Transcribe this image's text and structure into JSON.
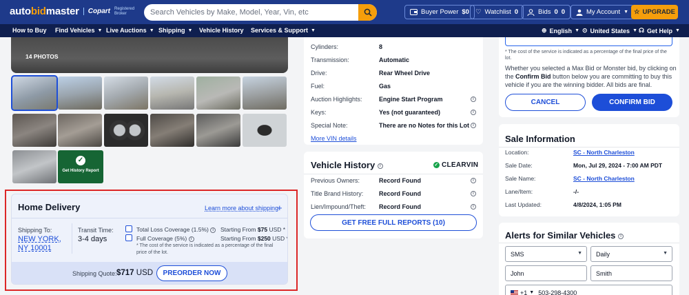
{
  "header": {
    "logo": {
      "auto": "auto",
      "bid": "bid",
      "master": "master",
      "partner": "Copart",
      "partner_note": "Registered Broker"
    },
    "search_placeholder": "Search Vehicles by Make, Model, Year, Vin, etc",
    "buyer_power_label": "Buyer Power",
    "buyer_power_value": "$0",
    "watchlist_label": "Watchlist",
    "watchlist_count": "0",
    "bids_label": "Bids",
    "bids_count_a": "0",
    "bids_count_b": "0",
    "account_label": "My Account",
    "upgrade_label": "UPGRADE"
  },
  "nav": {
    "items": [
      "How to Buy",
      "Find Vehicles",
      "Live Auctions",
      "Shipping",
      "Vehicle History",
      "Services & Support"
    ],
    "language": "English",
    "country": "United States",
    "help": "Get Help"
  },
  "gallery": {
    "photo_count": "14 PHOTOS",
    "history_report_label": "Get History Report"
  },
  "home_delivery": {
    "title": "Home Delivery",
    "learn_more": "Learn more about shipping",
    "shipping_to_label": "Shipping To:",
    "shipping_to_city": "NEW YORK, NY 10001",
    "transit_label": "Transit Time:",
    "transit_value": "3-4 days",
    "total_loss_label": "Total Loss Coverage (1.5%)",
    "total_loss_from": "Starting From",
    "total_loss_price": "$75",
    "total_loss_currency": "USD *",
    "full_cov_label": "Full Coverage (5%)",
    "full_cov_from": "Starting From",
    "full_cov_price": "$250",
    "full_cov_currency": "USD *",
    "coverage_note": "* The cost of the service is indicated as a percentage of the final price of the lot.",
    "quote_label": "Shipping Quote:",
    "quote_value": "$717",
    "quote_currency": "USD",
    "preorder_label": "PREORDER NOW"
  },
  "specs": {
    "rows": [
      {
        "k": "Cylinders:",
        "v": "8"
      },
      {
        "k": "Transmission:",
        "v": "Automatic"
      },
      {
        "k": "Drive:",
        "v": "Rear Wheel Drive"
      },
      {
        "k": "Fuel:",
        "v": "Gas"
      },
      {
        "k": "Auction Highlights:",
        "v": "Engine Start Program"
      },
      {
        "k": "Keys:",
        "v": "Yes (not guaranteed)"
      },
      {
        "k": "Special Note:",
        "v": "There are no Notes for this Lot"
      }
    ],
    "more_vin": "More VIN details"
  },
  "vehicle_history": {
    "title": "Vehicle History",
    "provider": "CLEARVIN",
    "rows": [
      {
        "k": "Previous Owners:",
        "v": "Record Found"
      },
      {
        "k": "Title Brand History:",
        "v": "Record Found"
      },
      {
        "k": "Lien/Impound/Theft:",
        "v": "Record Found"
      }
    ],
    "button": "GET FREE FULL REPORTS (10)"
  },
  "bid_confirm": {
    "note": "* The cost of the service is indicated as a percentage of the final price of the lot.",
    "text_a": "Whether you selected a Max Bid or Monster bid, by clicking on the",
    "text_bold": "Confirm Bid",
    "text_b": "button below you are committing to buy this vehicle if you are the winning bidder. All bids are final.",
    "cancel": "CANCEL",
    "confirm": "CONFIRM BID"
  },
  "sale_info": {
    "title": "Sale Information",
    "rows": [
      {
        "k": "Location:",
        "v": "SC - North Charleston"
      },
      {
        "k": "Sale Date:",
        "v": "Mon, Jul 29, 2024 - 7:00 AM PDT"
      },
      {
        "k": "Sale Name:",
        "v": "SC - North Charleston"
      },
      {
        "k": "Lane/Item:",
        "v": "-/-"
      },
      {
        "k": "Last Updated:",
        "v": "4/8/2024, 1:05 PM"
      }
    ]
  },
  "alerts": {
    "title": "Alerts for Similar Vehicles",
    "method": "SMS",
    "frequency": "Daily",
    "first_name": "John",
    "last_name": "Smith",
    "phone_code": "+1",
    "phone": "503-298-4300"
  },
  "colors": {
    "brand_blue": "#1e3a8a",
    "accent_orange": "#f59e0b",
    "link_blue": "#1d4ed8",
    "highlight_red": "#dc2626"
  }
}
